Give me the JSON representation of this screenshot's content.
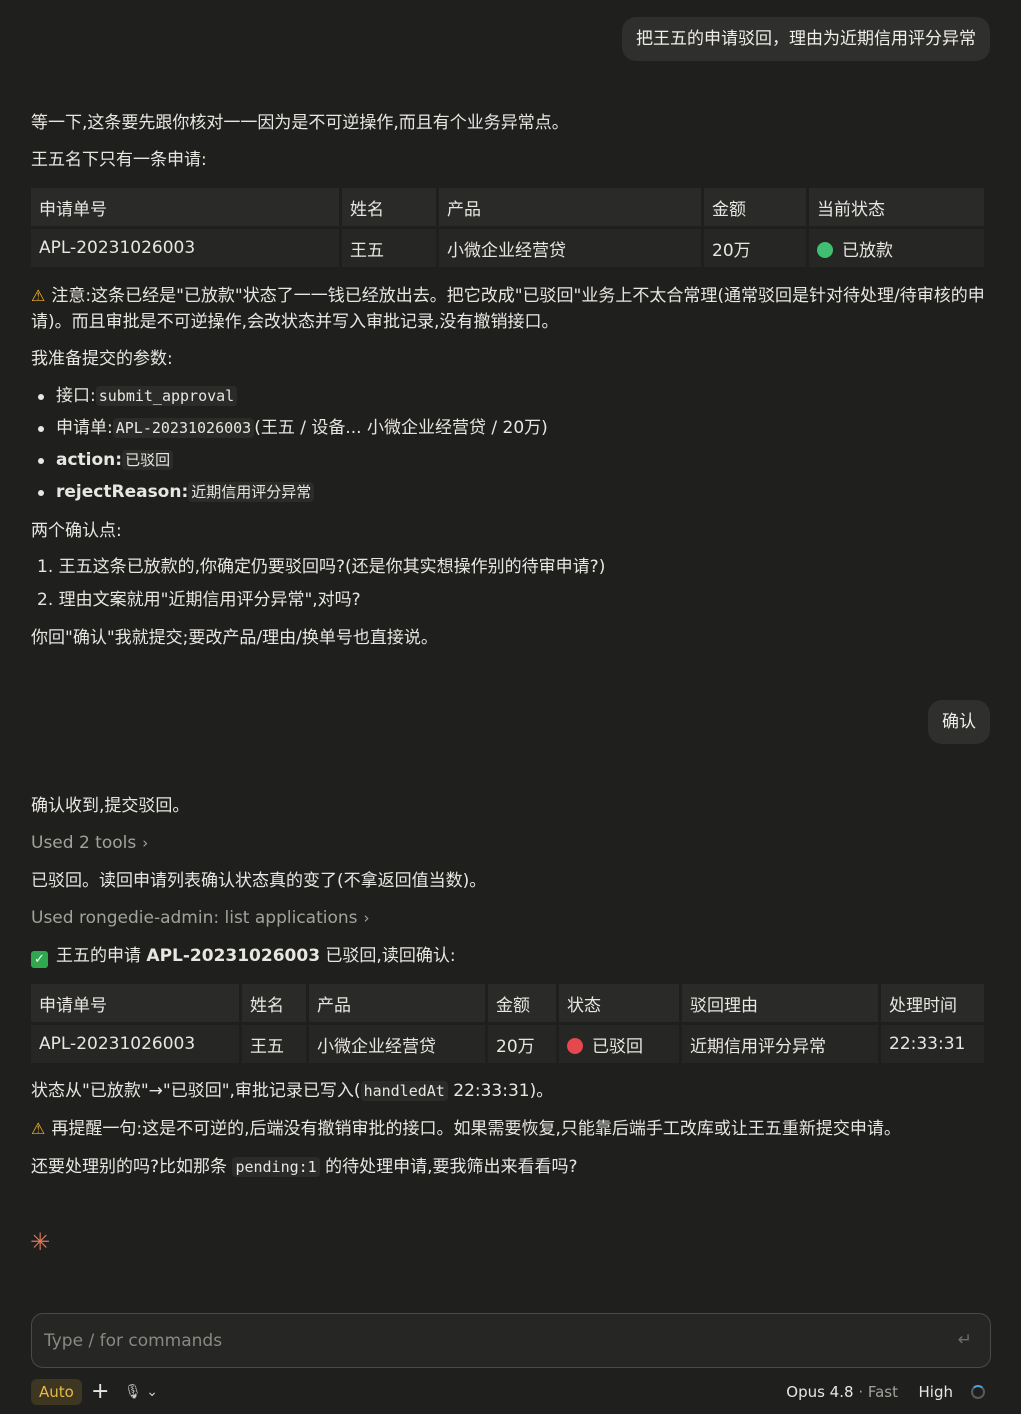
{
  "messages": {
    "user1": "把王五的申请驳回，理由为近期信用评分异常",
    "a1_intro": "等一下,这条要先跟你核对一一因为是不可逆操作,而且有个业务异常点。",
    "a1_only": "王五名下只有一条申请:",
    "table1": {
      "headers": [
        "申请单号",
        "姓名",
        "产品",
        "金额",
        "当前状态"
      ],
      "row": [
        "APL-20231026003",
        "王五",
        "小微企业经营贷",
        "20万",
        "已放款"
      ]
    },
    "a1_warn": "注意:这条已经是\"已放款\"状态了一一钱已经放出去。把它改成\"已驳回\"业务上不太合常理(通常驳回是针对待处理/待审核的申请)。而且审批是不可逆操作,会改状态并写入审批记录,没有撤销接口。",
    "a1_params_title": "我准备提交的参数:",
    "params": [
      {
        "key": "接口:",
        "code": "submit_approval",
        "rest": ""
      },
      {
        "key": "申请单:",
        "code": "APL-20231026003",
        "rest": "(王五 / 设备... 小微企业经营贷 / 20万)"
      },
      {
        "key": "action:",
        "code": "已驳回",
        "rest": ""
      },
      {
        "key": "rejectReason:",
        "code": "近期信用评分异常",
        "rest": ""
      }
    ],
    "a1_confirm_title": "两个确认点:",
    "confirm_points": [
      "1. 王五这条已放款的,你确定仍要驳回吗?(还是你其实想操作别的待审申请?)",
      "2. 理由文案就用\"近期信用评分异常\",对吗?"
    ],
    "a1_reply": "你回\"确认\"我就提交;要改产品/理由/换单号也直接说。",
    "user2": "确认",
    "a2_ack": "确认收到,提交驳回。",
    "a2_tools": "Used 2 tools",
    "a2_rejected": "已驳回。读回申请列表确认状态真的变了(不拿返回值当数)。",
    "a2_tool_list": "Used rongedie-admin: list applications",
    "a2_result_pre": "王五的申请 ",
    "a2_result_bold": "APL-20231026003",
    "a2_result_post": " 已驳回,读回确认:",
    "table2": {
      "headers": [
        "申请单号",
        "姓名",
        "产品",
        "金额",
        "状态",
        "驳回理由",
        "处理时间"
      ],
      "row": [
        "APL-20231026003",
        "王五",
        "小微企业经营贷",
        "20万",
        "已驳回",
        "近期信用评分异常",
        "22:33:31"
      ]
    },
    "a2_status_pre": "状态从\"已放款\"→\"已驳回\",审批记录已写入(",
    "a2_status_code": "handledAt",
    "a2_status_post": " 22:33:31)。",
    "a2_warn": "再提醒一句:这是不可逆的,后端没有撤销审批的接口。如果需要恢复,只能靠后端手工改库或让王五重新提交申请。",
    "a2_q_pre": "还要处理别的吗?比如那条 ",
    "a2_q_code": "pending:1",
    "a2_q_post": " 的待处理申请,要我筛出来看看吗?"
  },
  "input": {
    "placeholder": "Type / for commands"
  },
  "footer": {
    "mode": "Auto",
    "model": "Opus 4.8",
    "speed": "Fast",
    "effort": "High"
  },
  "colors": {
    "status_disbursed": "#3fbf6f",
    "status_rejected": "#e5484d",
    "accent": "#d97757",
    "warning": "#f0b429"
  }
}
